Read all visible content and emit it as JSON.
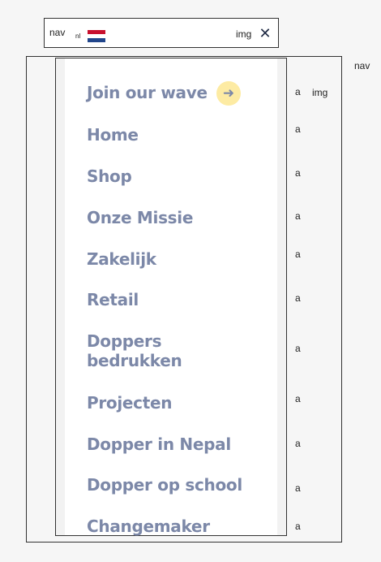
{
  "topbar": {
    "nav_tag": "nav",
    "lang_code": "nl",
    "img_tag": "img",
    "close_icon": "close-icon",
    "flag_icon": "netherlands-flag-icon"
  },
  "outer_nav": {
    "tag": "nav"
  },
  "menu": {
    "join": {
      "label": "Join our wave",
      "arrow_icon": "arrow-right-icon",
      "accent": "#fdeba3"
    },
    "items": [
      {
        "label": "Home"
      },
      {
        "label": "Shop"
      },
      {
        "label": "Onze Missie"
      },
      {
        "label": "Zakelijk"
      },
      {
        "label": "Retail"
      },
      {
        "label": "Doppers bedrukken",
        "lines": [
          "Doppers",
          "bedrukken"
        ]
      },
      {
        "label": "Projecten"
      },
      {
        "label": "Dopper in Nepal"
      },
      {
        "label": "Dopper op school"
      },
      {
        "label": "Changemaker"
      }
    ]
  },
  "side_tags": {
    "a": "a",
    "img": "img"
  },
  "colors": {
    "menu_text": "#7c88a8",
    "close": "#1f2a44"
  }
}
